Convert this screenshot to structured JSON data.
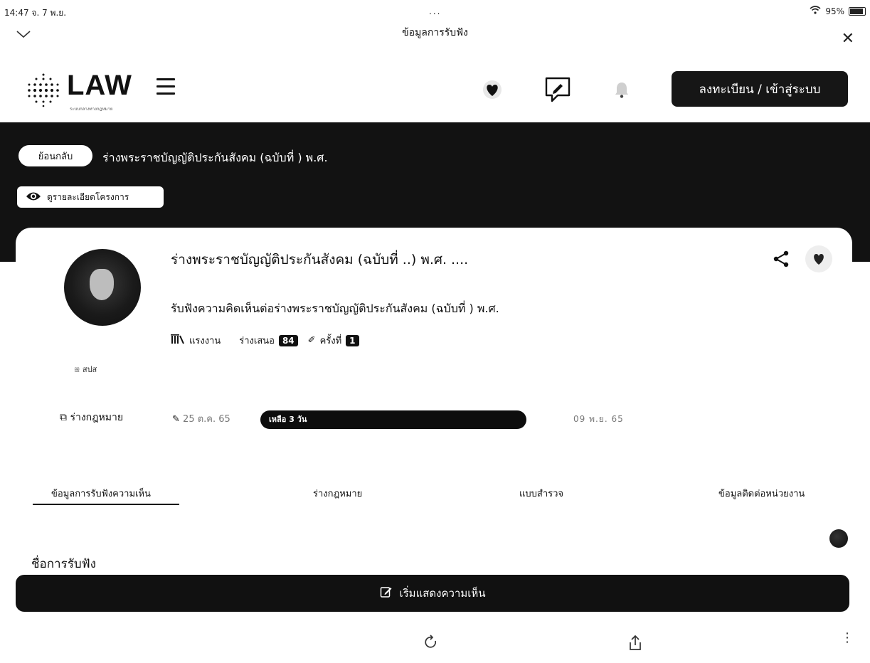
{
  "status": {
    "time": "14:47",
    "date": "จ. 7 พ.ย.",
    "dots": "...",
    "battery": "95%"
  },
  "browser": {
    "title": "ข้อมูลการรับฟัง"
  },
  "header": {
    "logo_text": "LAW",
    "logo_sub": "ระบบกลางทางกฎหมาย",
    "login_label": "ลงทะเบียน / เข้าสู่ระบบ"
  },
  "banner": {
    "back_label": "ย้อนกลับ",
    "title": "ร่างพระราชบัญญัติประกันสังคม (ฉบับที่ ) พ.ศ.",
    "detail_label": "ดูรายละเอียดโครงการ"
  },
  "card": {
    "title": "ร่างพระราชบัญญัติประกันสังคม (ฉบับที่ ..) พ.ศ. ....",
    "subtitle": "รับฟังความคิดเห็นต่อร่างพระราชบัญญัติประกันสังคม (ฉบับที่ ) พ.ศ.",
    "agency_label": "แรงงาน",
    "proposer_label": "ร่างเสนอ",
    "proposer_count": "84",
    "round_label": "ครั้งที่",
    "round_value": "1",
    "org": "สปส",
    "draft_label": "ร่างกฎหมาย",
    "date_start": "25 ต.ค. 65",
    "remain_label": "เหลือ 3 วัน",
    "date_end": "09 พ.ย. 65"
  },
  "tabs": [
    {
      "label": "ข้อมูลการรับฟังความเห็น"
    },
    {
      "label": "ร่างกฎหมาย"
    },
    {
      "label": "แบบสำรวจ"
    },
    {
      "label": "ข้อมูลติดต่อหน่วยงาน"
    }
  ],
  "section": {
    "title": "ชื่อการรับฟัง"
  },
  "cta": {
    "label": "เริ่มแสดงความเห็น"
  },
  "colors": {
    "dark": "#121212",
    "button": "#161616",
    "white": "#ffffff"
  },
  "icons": [
    "chevron-down-icon",
    "close-icon",
    "heart-icon",
    "chat-edit-icon",
    "bell-icon",
    "share-icon",
    "eye-icon",
    "reload-icon",
    "upload-icon",
    "kebab-icon"
  ]
}
